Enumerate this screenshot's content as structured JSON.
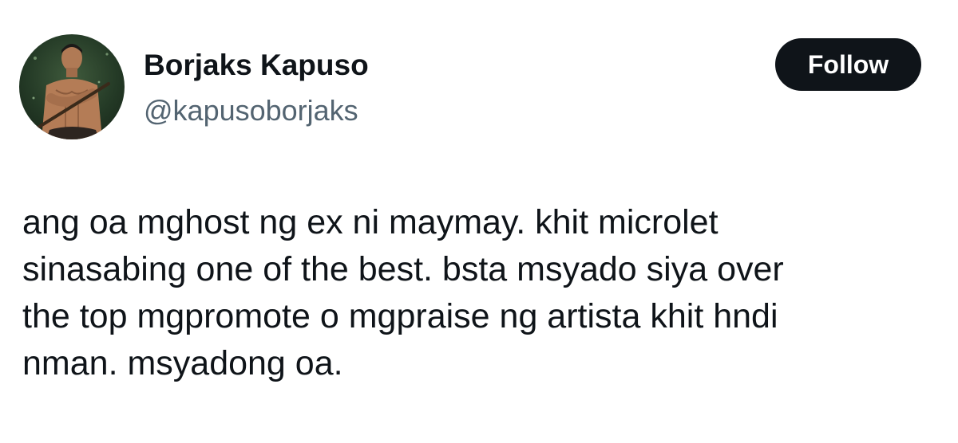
{
  "author": {
    "display_name": "Borjaks Kapuso",
    "handle": "@kapusoborjaks",
    "avatar_icon": "profile-photo-avatar"
  },
  "actions": {
    "follow_label": "Follow"
  },
  "tweet": {
    "lines": [
      "ang oa mghost ng ex ni maymay. khit microlet",
      "sinasabing one of the best. bsta msyado siya over",
      "the top mgpromote o mgpraise ng artista khit hndi",
      "nman. msyadong oa."
    ]
  },
  "colors": {
    "text_primary": "#0f1419",
    "text_secondary": "#536471",
    "follow_button_bg": "#0f1419",
    "follow_button_text": "#ffffff",
    "background": "#ffffff"
  }
}
